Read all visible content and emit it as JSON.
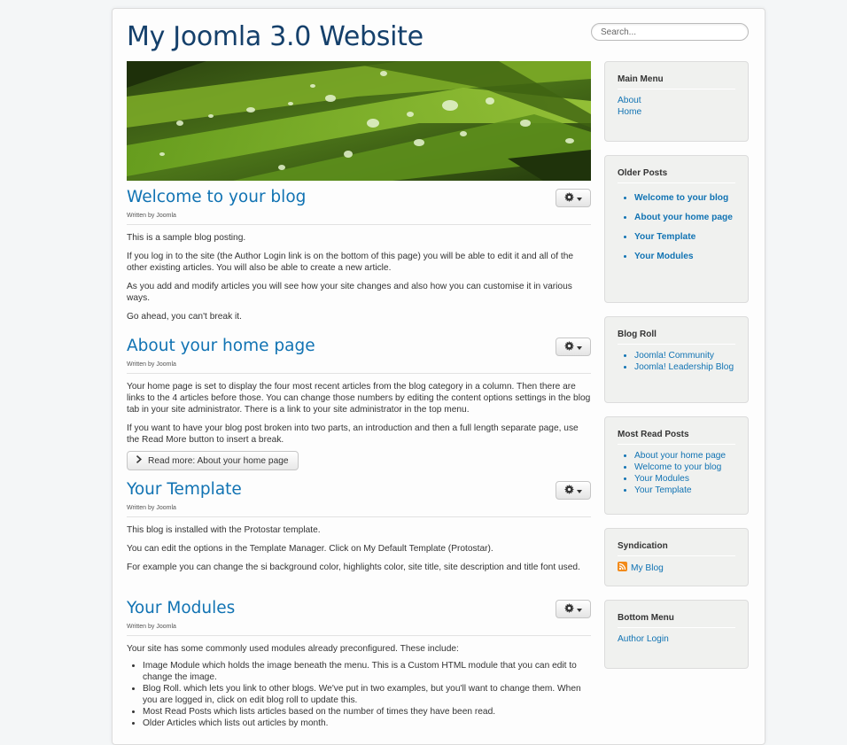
{
  "site": {
    "title": "My Joomla 3.0 Website"
  },
  "search": {
    "placeholder": "Search..."
  },
  "articles": [
    {
      "title": "Welcome to your blog",
      "byline": "Written by Joomla",
      "paragraphs": [
        "This is a sample blog posting.",
        "If you log in to the site (the Author Login link is on the bottom of this page) you will be able to edit it and all of the other existing articles. You will also be able to create a new article.",
        "As you add and modify articles you will see how your site changes and also how you can customise it in various ways.",
        "Go ahead, you can't break it."
      ]
    },
    {
      "title": "About your home page",
      "byline": "Written by Joomla",
      "paragraphs": [
        "Your home page is set to display the four most recent articles from the blog category in a column. Then there are links to the 4 articles before those. You can change those numbers by editing the content options settings in the blog tab in your site administrator. There is a link to your site administrator in the top menu.",
        "If you want to have your blog post broken into two parts, an introduction and then a full length separate page, use the Read More button to insert a break."
      ],
      "readmore": "Read more: About your home page"
    },
    {
      "title": "Your Template",
      "byline": "Written by Joomla",
      "paragraphs": [
        "This blog is installed with the Protostar template.",
        "You can edit the options in the Template Manager. Click on My Default Template (Protostar).",
        "For example you can change the si background color, highlights color, site title, site description and title font used."
      ]
    },
    {
      "title": "Your Modules",
      "byline": "Written by Joomla",
      "paragraphs": [
        "Your site has some commonly used modules already preconfigured. These include:"
      ],
      "list": [
        "Image Module which holds the image beneath the menu. This is a Custom HTML module that you can edit to change the image.",
        "Blog Roll. which lets you link to other blogs. We've put in two examples, but you'll want to change them. When you are logged in, click on edit blog roll to update this.",
        "Most Read Posts which lists articles based on the number of times they have been read.",
        "Older Articles which lists out articles by month."
      ]
    }
  ],
  "sidebar": {
    "main_menu": {
      "title": "Main Menu",
      "items": [
        "About",
        "Home"
      ]
    },
    "older_posts": {
      "title": "Older Posts",
      "items": [
        "Welcome to your blog",
        "About your home page",
        "Your Template",
        "Your Modules"
      ]
    },
    "blog_roll": {
      "title": "Blog Roll",
      "items": [
        "Joomla! Community",
        "Joomla! Leadership Blog"
      ]
    },
    "most_read": {
      "title": "Most Read Posts",
      "items": [
        "About your home page",
        "Welcome to your blog",
        "Your Modules",
        "Your Template"
      ]
    },
    "syndication": {
      "title": "Syndication",
      "feed_label": "My Blog"
    },
    "bottom_menu": {
      "title": "Bottom Menu",
      "items": [
        "Author Login"
      ]
    }
  },
  "icons": {
    "gear": "gear-icon",
    "caret": "caret-down-icon",
    "chevron": "chevron-right-icon",
    "rss": "rss-icon"
  },
  "colors": {
    "link": "#1173b3",
    "title": "#15406b",
    "rss": "#f28a1a"
  }
}
